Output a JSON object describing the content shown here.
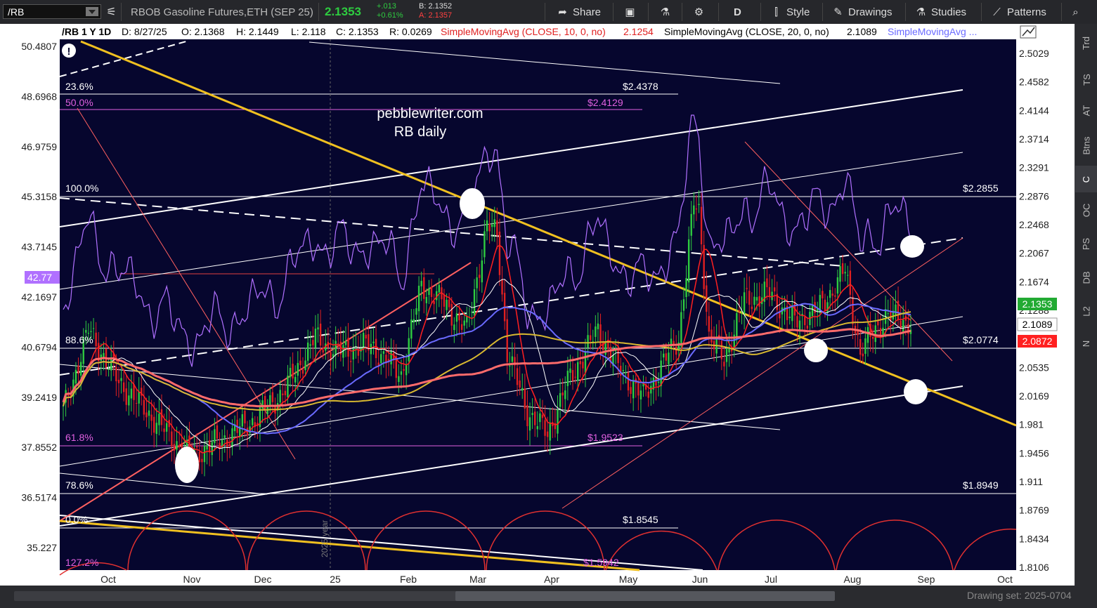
{
  "toolbar": {
    "symbol": "/RB",
    "instrument": "RBOB Gasoline Futures,ETH (SEP 25)",
    "last": "2.1353",
    "change": "+.013",
    "change_pct": "+0.61%",
    "bid": "B: 2.1352",
    "ask": "A: 2.1357",
    "share": "Share",
    "aggregation": "D",
    "style": "Style",
    "drawings": "Drawings",
    "studies": "Studies",
    "patterns": "Patterns"
  },
  "header": {
    "title": "/RB 1 Y 1D",
    "date": "D: 8/27/25",
    "open": "O: 2.1368",
    "high": "H: 2.1449",
    "low": "L: 2.118",
    "close": "C: 2.1353",
    "range": "R: 0.0269",
    "sma10_label": "SimpleMovingAvg (CLOSE, 10, 0, no)",
    "sma10_value": "2.1254",
    "sma20_label": "SimpleMovingAvg (CLOSE, 20, 0, no)",
    "sma20_value": "2.1089",
    "sma_more": "SimpleMovingAvg ..."
  },
  "annotations": {
    "watermark": "pebblewriter.com",
    "subtitle": "RB daily",
    "year_marker": "2025 year",
    "fib": [
      {
        "pct": "23.6%",
        "price": "$2.4378"
      },
      {
        "pct": "50.0%",
        "price": "$2.4129"
      },
      {
        "pct": "100.0%",
        "price": "$2.2855"
      },
      {
        "pct": "88.6%",
        "price": "$2.0774"
      },
      {
        "pct": "61.8%",
        "price": "$1.9523"
      },
      {
        "pct": "78.6%",
        "price": "$1.8949"
      },
      {
        "pct": "0.0%",
        "price": "$1.8545"
      },
      {
        "pct": "127.2%",
        "price": "$1.5942"
      }
    ]
  },
  "colors": {
    "background": "#06062e",
    "candle_up": "#2ecc40",
    "candle_down": "#e02020",
    "sma_fast": "#ff2020",
    "sma_white": "#ffffff",
    "sma_blue": "#6a6aff",
    "sma_gold": "#d8b830",
    "sma_salmon": "#ff6b6b",
    "rsi": "#b070ff",
    "trend_gold": "#f0c020"
  },
  "chart_data": {
    "type": "candlestick",
    "x_labels": [
      "Oct",
      "Nov",
      "Dec",
      "25",
      "Feb",
      "Mar",
      "Apr",
      "May",
      "Jun",
      "Jul",
      "Aug",
      "Sep",
      "Oct"
    ],
    "y_right_ticks": [
      "2.5029",
      "2.4582",
      "2.4144",
      "2.3714",
      "2.3291",
      "2.2876",
      "2.2468",
      "2.2067",
      "2.1674",
      "2.1288",
      "2.0910",
      "2.0535",
      "2.0169",
      "1.981",
      "1.9456",
      "1.911",
      "1.8769",
      "1.8434",
      "1.8106"
    ],
    "y_left_ticks": [
      "50.4807",
      "48.6968",
      "46.9759",
      "45.3158",
      "43.7145",
      "42.1697",
      "40.6794",
      "39.2419",
      "37.8552",
      "36.5174",
      "35.227"
    ],
    "price_labels": [
      {
        "text": "2.1353",
        "bg": "#22aa33",
        "fg": "#ffffff"
      },
      {
        "text": "2.1089",
        "bg": "#ffffff",
        "fg": "#000000"
      },
      {
        "text": "2.0872",
        "bg": "#ff2020",
        "fg": "#ffffff"
      }
    ],
    "left_label": "42.77",
    "ylim": [
      1.8106,
      2.5029
    ],
    "series": [
      {
        "name": "Close",
        "keys": [
          [
            0,
            2.02
          ],
          [
            10,
            2.13
          ],
          [
            22,
            2.06
          ],
          [
            36,
            2.01
          ],
          [
            50,
            1.96
          ],
          [
            62,
            1.98
          ],
          [
            76,
            2.01
          ],
          [
            88,
            2.05
          ],
          [
            100,
            2.12
          ],
          [
            108,
            2.1
          ],
          [
            122,
            2.11
          ],
          [
            134,
            2.07
          ],
          [
            142,
            2.19
          ],
          [
            150,
            2.17
          ],
          [
            160,
            2.13
          ],
          [
            168,
            2.27
          ],
          [
            172,
            2.26
          ],
          [
            176,
            2.1
          ],
          [
            184,
            2.02
          ],
          [
            192,
            1.99
          ],
          [
            200,
            2.06
          ],
          [
            212,
            2.13
          ],
          [
            220,
            2.08
          ],
          [
            230,
            2.04
          ],
          [
            244,
            2.12
          ],
          [
            250,
            2.3
          ],
          [
            252,
            2.29
          ],
          [
            256,
            2.12
          ],
          [
            262,
            2.09
          ],
          [
            270,
            2.17
          ],
          [
            280,
            2.18
          ],
          [
            290,
            2.14
          ],
          [
            300,
            2.16
          ],
          [
            310,
            2.21
          ],
          [
            316,
            2.1
          ],
          [
            326,
            2.15
          ],
          [
            336,
            2.14
          ]
        ]
      }
    ]
  }
}
